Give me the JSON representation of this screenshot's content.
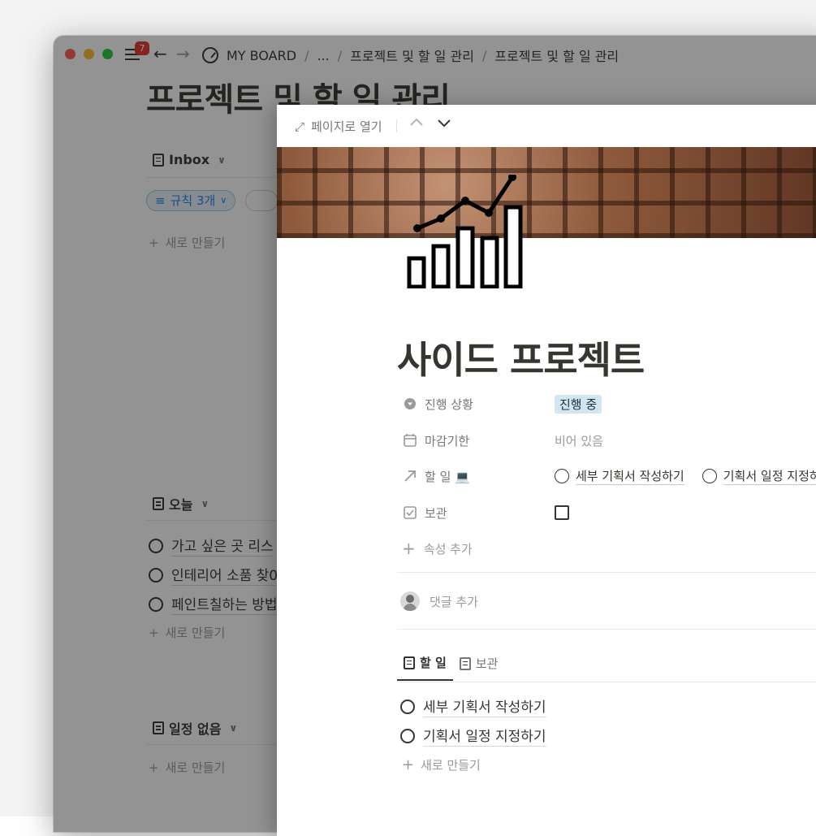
{
  "toolbar": {
    "badge_count": "7",
    "breadcrumbs": [
      "MY BOARD",
      "...",
      "프로젝트 및 할 일 관리",
      "프로젝트 및 할 일 관리"
    ],
    "separators": [
      "/",
      "/",
      "/"
    ]
  },
  "background_page": {
    "title": "프로젝트 및 할 일 관리",
    "sections": [
      {
        "name": "Inbox",
        "filter_label": "규칙 3개",
        "new_label": "새로 만들기"
      },
      {
        "name": "오늘",
        "items": [
          "가고 싶은 곳 리스",
          "인테리어 소품 찾0",
          "페인트칠하는 방법"
        ],
        "new_label": "새로 만들기"
      },
      {
        "name": "일정 없음",
        "new_label": "새로 만들기"
      }
    ]
  },
  "peek": {
    "open_as_page": "페이지로 열기",
    "title": "사이드 프로젝트",
    "properties": [
      {
        "label": "진행 상황",
        "value": "진행 중",
        "icon": "status-icon"
      },
      {
        "label": "마감기한",
        "value": "비어 있음",
        "icon": "calendar-icon"
      },
      {
        "label": "할 일 💻",
        "icon": "relation-arrow-icon",
        "items": [
          "세부 기획서 작성하기",
          "기획서 일정 지정하"
        ]
      },
      {
        "label": "보관",
        "icon": "checkbox-icon",
        "checked": false
      }
    ],
    "add_property": "속성 추가",
    "add_comment": "댓글 추가",
    "tabs": [
      "할 일",
      "보관"
    ],
    "active_tab": "할 일",
    "todos": [
      "세부 기획서 작성하기",
      "기획서 일정 지정하기"
    ],
    "new_label": "새로 만들기"
  },
  "colors": {
    "status_tag_bg": "#d3e5ef",
    "badge": "#e0362c",
    "filter_pill": "#2383e2"
  }
}
